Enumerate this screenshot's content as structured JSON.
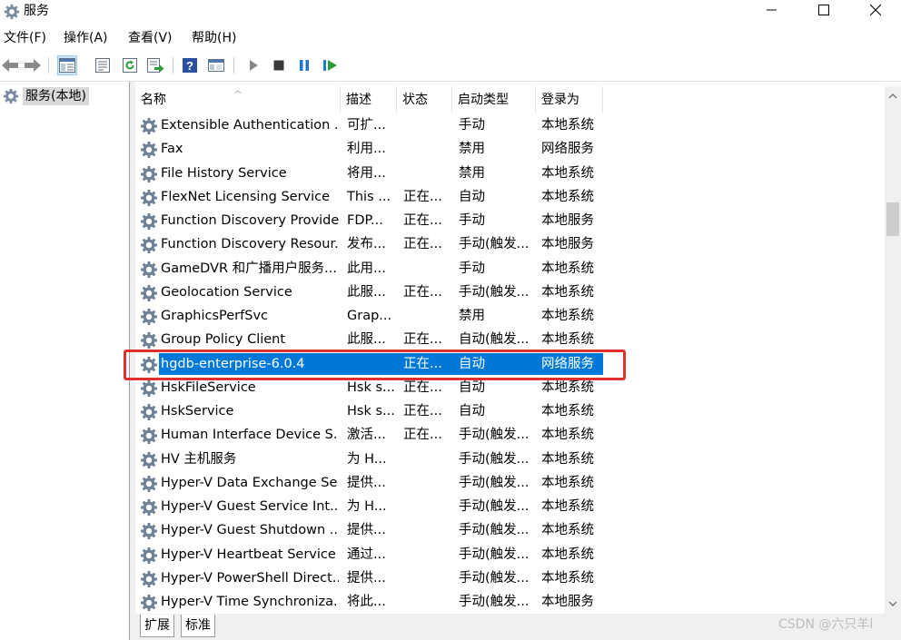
{
  "window": {
    "title": "服务"
  },
  "menu": [
    "文件(F)",
    "操作(A)",
    "查看(V)",
    "帮助(H)"
  ],
  "toolbar": {
    "buttons": [
      "back-icon",
      "forward-icon",
      "show-tree-icon",
      "properties-icon",
      "refresh-icon",
      "export-icon",
      "help-icon",
      "console-view-icon",
      "start-icon",
      "stop-icon",
      "pause-icon",
      "resume-icon"
    ]
  },
  "tree": {
    "root_label": "服务(本地)"
  },
  "columns": {
    "name": "名称",
    "description": "描述",
    "status": "状态",
    "startup": "启动类型",
    "logon": "登录为"
  },
  "services": [
    {
      "name": "Extensible Authentication ...",
      "description": "可扩...",
      "status": "",
      "startup": "手动",
      "logon": "本地系统"
    },
    {
      "name": "Fax",
      "description": "利用...",
      "status": "",
      "startup": "禁用",
      "logon": "网络服务"
    },
    {
      "name": "File History Service",
      "description": "将用...",
      "status": "",
      "startup": "禁用",
      "logon": "本地系统"
    },
    {
      "name": "FlexNet Licensing Service",
      "description": "This ...",
      "status": "正在...",
      "startup": "自动",
      "logon": "本地系统"
    },
    {
      "name": "Function Discovery Provide...",
      "description": "FDP...",
      "status": "正在...",
      "startup": "手动",
      "logon": "本地服务"
    },
    {
      "name": "Function Discovery Resour...",
      "description": "发布...",
      "status": "正在...",
      "startup": "手动(触发...",
      "logon": "本地服务"
    },
    {
      "name": "GameDVR 和广播用户服务...",
      "description": "此用...",
      "status": "",
      "startup": "手动",
      "logon": "本地系统"
    },
    {
      "name": "Geolocation Service",
      "description": "此服...",
      "status": "正在...",
      "startup": "手动(触发...",
      "logon": "本地系统"
    },
    {
      "name": "GraphicsPerfSvc",
      "description": "Grap...",
      "status": "",
      "startup": "禁用",
      "logon": "本地系统"
    },
    {
      "name": "Group Policy Client",
      "description": "此服...",
      "status": "正在...",
      "startup": "自动(触发...",
      "logon": "本地系统"
    },
    {
      "name": "hgdb-enterprise-6.0.4",
      "description": "",
      "status": "正在...",
      "startup": "自动",
      "logon": "网络服务",
      "selected": true
    },
    {
      "name": "HskFileService",
      "description": "Hsk s...",
      "status": "正在...",
      "startup": "自动",
      "logon": "本地系统"
    },
    {
      "name": "HskService",
      "description": "Hsk s...",
      "status": "正在...",
      "startup": "自动",
      "logon": "本地系统"
    },
    {
      "name": "Human Interface Device S...",
      "description": "激活...",
      "status": "正在...",
      "startup": "手动(触发...",
      "logon": "本地系统"
    },
    {
      "name": "HV 主机服务",
      "description": "为 H...",
      "status": "",
      "startup": "手动(触发...",
      "logon": "本地系统"
    },
    {
      "name": "Hyper-V Data Exchange Se...",
      "description": "提供...",
      "status": "",
      "startup": "手动(触发...",
      "logon": "本地系统"
    },
    {
      "name": "Hyper-V Guest Service Int...",
      "description": "为 H...",
      "status": "",
      "startup": "手动(触发...",
      "logon": "本地系统"
    },
    {
      "name": "Hyper-V Guest Shutdown ...",
      "description": "提供...",
      "status": "",
      "startup": "手动(触发...",
      "logon": "本地系统"
    },
    {
      "name": "Hyper-V Heartbeat Service",
      "description": "通过...",
      "status": "",
      "startup": "手动(触发...",
      "logon": "本地系统"
    },
    {
      "name": "Hyper-V PowerShell Direct...",
      "description": "提供...",
      "status": "",
      "startup": "手动(触发...",
      "logon": "本地系统"
    },
    {
      "name": "Hyper-V Time Synchronizа...",
      "description": "将此...",
      "status": "",
      "startup": "手动(触发...",
      "logon": "本地服务"
    }
  ],
  "tabs": {
    "extended": "扩展",
    "standard": "标准"
  },
  "watermark": "CSDN @六只羊l",
  "colors": {
    "selection": "#0078d7",
    "annotation": "#e0302c"
  }
}
